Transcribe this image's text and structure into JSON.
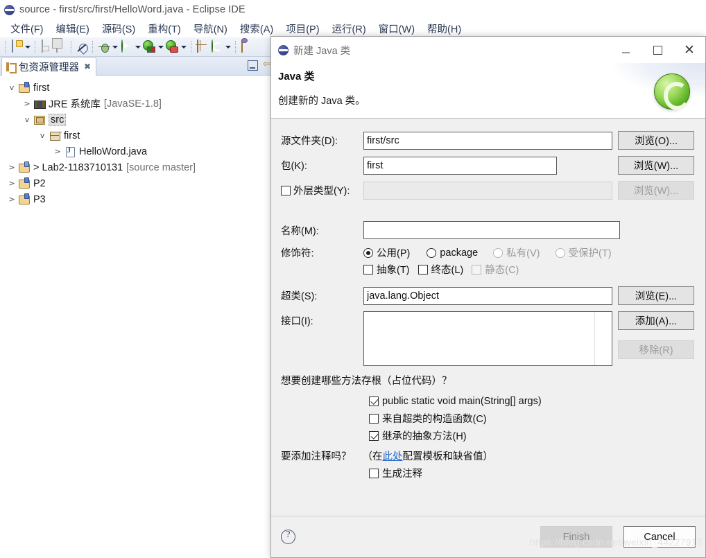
{
  "window": {
    "title": "source - first/src/first/HelloWord.java - Eclipse IDE",
    "logo_icon": "eclipse-logo-icon"
  },
  "menubar": {
    "items": [
      {
        "label": "文件(F)"
      },
      {
        "label": "编辑(E)"
      },
      {
        "label": "源码(S)"
      },
      {
        "label": "重构(T)"
      },
      {
        "label": "导航(N)"
      },
      {
        "label": "搜索(A)"
      },
      {
        "label": "项目(P)"
      },
      {
        "label": "运行(R)"
      },
      {
        "label": "窗口(W)"
      },
      {
        "label": "帮助(H)"
      }
    ]
  },
  "toolbar": {
    "icons": [
      "new-file-icon",
      "new-file-dropdown-icon",
      "save-icon",
      "save-all-icon",
      "skip-all-breakpoints-icon",
      "debug-icon",
      "debug-dropdown-icon",
      "run-icon",
      "run-dropdown-icon",
      "run-external-tools-icon",
      "run-external-dropdown-icon",
      "run-coverage-icon",
      "run-coverage-dropdown-icon",
      "new-java-project-icon",
      "new-java-class-icon",
      "new-dropdown-icon",
      "open-type-icon"
    ]
  },
  "explorer": {
    "tab_label": "包资源管理器",
    "tab_icon": "package-explorer-icon",
    "close_icon": "close-icon",
    "toolbar_icons": [
      "minimize-icon",
      "collapse-all-icon"
    ],
    "tree": [
      {
        "indent": 0,
        "twisty": "v",
        "icon": "java-project-icon",
        "label": "first",
        "suffix": "",
        "selected": false
      },
      {
        "indent": 1,
        "twisty": ">",
        "icon": "jre-library-icon",
        "label": "JRE 系统库",
        "suffix": "[JavaSE-1.8]",
        "selected": false
      },
      {
        "indent": 1,
        "twisty": "v",
        "icon": "source-folder-icon",
        "label": "src",
        "suffix": "",
        "selected": true
      },
      {
        "indent": 2,
        "twisty": "v",
        "icon": "package-icon",
        "label": "first",
        "suffix": "",
        "selected": false
      },
      {
        "indent": 3,
        "twisty": ">",
        "icon": "java-file-icon",
        "label": "HelloWord.java",
        "suffix": "",
        "selected": false
      },
      {
        "indent": 0,
        "twisty": ">",
        "icon": "java-project-repo-icon",
        "label": "> Lab2-1183710131",
        "suffix": "[source master]",
        "selected": false
      },
      {
        "indent": 0,
        "twisty": ">",
        "icon": "java-project-icon",
        "label": "P2",
        "suffix": "",
        "selected": false
      },
      {
        "indent": 0,
        "twisty": ">",
        "icon": "java-project-icon",
        "label": "P3",
        "suffix": "",
        "selected": false
      }
    ]
  },
  "dialog": {
    "title": "新建 Java 类",
    "title_icon": "eclipse-logo-icon",
    "window_buttons": {
      "minimize": "minimize-icon",
      "maximize": "maximize-icon",
      "close": "close-icon"
    },
    "header": {
      "heading": "Java 类",
      "description": "创建新的 Java 类。",
      "badge_icon": "java-class-wizard-icon"
    },
    "fields": {
      "source_folder": {
        "label": "源文件夹(D):",
        "value": "first/src",
        "button": "浏览(O)..."
      },
      "package": {
        "label": "包(K):",
        "value": "first",
        "button": "浏览(W)..."
      },
      "enclosing_type": {
        "label": "外层类型(Y):",
        "checked": false,
        "value": "",
        "button": "浏览(W)...",
        "disabled": true
      },
      "name": {
        "label": "名称(M):",
        "value": ""
      },
      "modifiers": {
        "label": "修饰符:",
        "radios": [
          {
            "label": "公用(P)",
            "checked": true,
            "disabled": false
          },
          {
            "label": "package",
            "checked": false,
            "disabled": false
          },
          {
            "label": "私有(V)",
            "checked": false,
            "disabled": true
          },
          {
            "label": "受保护(T)",
            "checked": false,
            "disabled": true
          }
        ],
        "checkboxes": [
          {
            "label": "抽象(T)",
            "checked": false,
            "disabled": false
          },
          {
            "label": "终态(L)",
            "checked": false,
            "disabled": false
          },
          {
            "label": "静态(C)",
            "checked": false,
            "disabled": true
          }
        ]
      },
      "superclass": {
        "label": "超类(S):",
        "value": "java.lang.Object",
        "button": "浏览(E)..."
      },
      "interfaces": {
        "label": "接口(I):",
        "items": [],
        "add_button": "添加(A)...",
        "remove_button": "移除(R)",
        "remove_disabled": true
      }
    },
    "stubs": {
      "question": "想要创建哪些方法存根（占位代码）？",
      "options": [
        {
          "label": "public static void main(String[] args)",
          "checked": true
        },
        {
          "label": "来自超类的构造函数(C)",
          "checked": false
        },
        {
          "label": "继承的抽象方法(H)",
          "checked": true
        }
      ]
    },
    "comments": {
      "question_prefix": "要添加注释吗？",
      "paren_open": "（在",
      "link": "此处",
      "paren_rest": "配置模板和缺省值）",
      "option": {
        "label": "生成注释",
        "checked": false
      }
    },
    "footer": {
      "help_icon": "help-icon",
      "finish_label": "Finish",
      "finish_disabled": true,
      "cancel_label": "Cancel"
    }
  },
  "watermark": "https://blog.csdn.net/weixin_44227917",
  "colors": {
    "toolbar_top": "#f2f5fa",
    "toolbar_bottom": "#e4eaf3",
    "dialog_bg": "#f0f0f0",
    "link": "#1c62c9",
    "selection": "#e0e0e0",
    "accent_green": "#5eb327"
  }
}
